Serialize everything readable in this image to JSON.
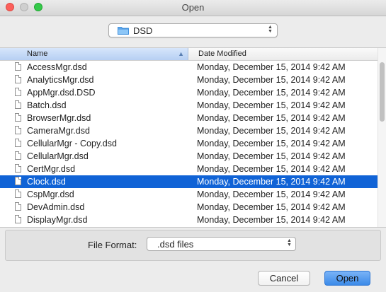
{
  "window": {
    "title": "Open"
  },
  "location": {
    "folder": "DSD",
    "icon": "folder-icon"
  },
  "columns": {
    "name": "Name",
    "date_modified": "Date Modified"
  },
  "files": [
    {
      "name": "AccessMgr.dsd",
      "modified": "Monday, December 15, 2014 9:42 AM",
      "selected": false
    },
    {
      "name": "AnalyticsMgr.dsd",
      "modified": "Monday, December 15, 2014 9:42 AM",
      "selected": false
    },
    {
      "name": "AppMgr.dsd.DSD",
      "modified": "Monday, December 15, 2014 9:42 AM",
      "selected": false
    },
    {
      "name": "Batch.dsd",
      "modified": "Monday, December 15, 2014 9:42 AM",
      "selected": false
    },
    {
      "name": "BrowserMgr.dsd",
      "modified": "Monday, December 15, 2014 9:42 AM",
      "selected": false
    },
    {
      "name": "CameraMgr.dsd",
      "modified": "Monday, December 15, 2014 9:42 AM",
      "selected": false
    },
    {
      "name": "CellularMgr - Copy.dsd",
      "modified": "Monday, December 15, 2014 9:42 AM",
      "selected": false
    },
    {
      "name": "CellularMgr.dsd",
      "modified": "Monday, December 15, 2014 9:42 AM",
      "selected": false
    },
    {
      "name": "CertMgr.dsd",
      "modified": "Monday, December 15, 2014 9:42 AM",
      "selected": false
    },
    {
      "name": "Clock.dsd",
      "modified": "Monday, December 15, 2014 9:42 AM",
      "selected": true
    },
    {
      "name": "CspMgr.dsd",
      "modified": "Monday, December 15, 2014 9:42 AM",
      "selected": false
    },
    {
      "name": "DevAdmin.dsd",
      "modified": "Monday, December 15, 2014 9:42 AM",
      "selected": false
    },
    {
      "name": "DisplayMgr.dsd",
      "modified": "Monday, December 15, 2014 9:42 AM",
      "selected": false
    }
  ],
  "format": {
    "label": "File Format:",
    "selected": ".dsd files"
  },
  "buttons": {
    "cancel": "Cancel",
    "open": "Open"
  },
  "colors": {
    "selection": "#1063d6",
    "accent": "#3b8ae8"
  }
}
